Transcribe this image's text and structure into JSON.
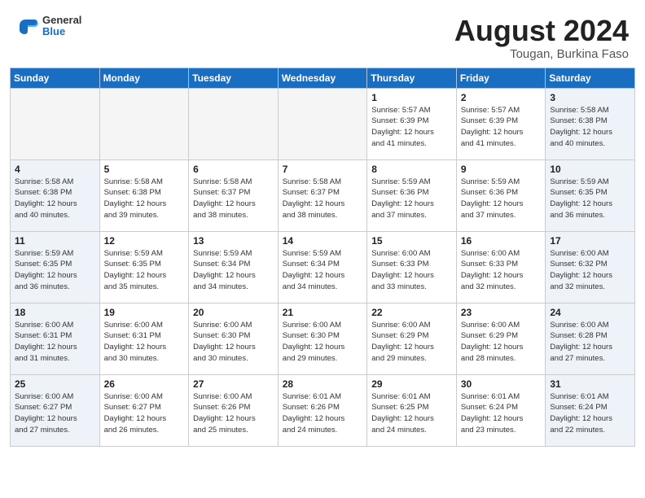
{
  "header": {
    "logo_general": "General",
    "logo_blue": "Blue",
    "title": "August 2024",
    "location": "Tougan, Burkina Faso"
  },
  "calendar": {
    "weekdays": [
      "Sunday",
      "Monday",
      "Tuesday",
      "Wednesday",
      "Thursday",
      "Friday",
      "Saturday"
    ],
    "weeks": [
      [
        {
          "day": "",
          "info": "",
          "type": "empty"
        },
        {
          "day": "",
          "info": "",
          "type": "empty"
        },
        {
          "day": "",
          "info": "",
          "type": "empty"
        },
        {
          "day": "",
          "info": "",
          "type": "empty"
        },
        {
          "day": "1",
          "info": "Sunrise: 5:57 AM\nSunset: 6:39 PM\nDaylight: 12 hours\nand 41 minutes.",
          "type": "weekday"
        },
        {
          "day": "2",
          "info": "Sunrise: 5:57 AM\nSunset: 6:39 PM\nDaylight: 12 hours\nand 41 minutes.",
          "type": "weekday"
        },
        {
          "day": "3",
          "info": "Sunrise: 5:58 AM\nSunset: 6:38 PM\nDaylight: 12 hours\nand 40 minutes.",
          "type": "weekend"
        }
      ],
      [
        {
          "day": "4",
          "info": "Sunrise: 5:58 AM\nSunset: 6:38 PM\nDaylight: 12 hours\nand 40 minutes.",
          "type": "weekend"
        },
        {
          "day": "5",
          "info": "Sunrise: 5:58 AM\nSunset: 6:38 PM\nDaylight: 12 hours\nand 39 minutes.",
          "type": "weekday"
        },
        {
          "day": "6",
          "info": "Sunrise: 5:58 AM\nSunset: 6:37 PM\nDaylight: 12 hours\nand 38 minutes.",
          "type": "weekday"
        },
        {
          "day": "7",
          "info": "Sunrise: 5:58 AM\nSunset: 6:37 PM\nDaylight: 12 hours\nand 38 minutes.",
          "type": "weekday"
        },
        {
          "day": "8",
          "info": "Sunrise: 5:59 AM\nSunset: 6:36 PM\nDaylight: 12 hours\nand 37 minutes.",
          "type": "weekday"
        },
        {
          "day": "9",
          "info": "Sunrise: 5:59 AM\nSunset: 6:36 PM\nDaylight: 12 hours\nand 37 minutes.",
          "type": "weekday"
        },
        {
          "day": "10",
          "info": "Sunrise: 5:59 AM\nSunset: 6:35 PM\nDaylight: 12 hours\nand 36 minutes.",
          "type": "weekend"
        }
      ],
      [
        {
          "day": "11",
          "info": "Sunrise: 5:59 AM\nSunset: 6:35 PM\nDaylight: 12 hours\nand 36 minutes.",
          "type": "weekend"
        },
        {
          "day": "12",
          "info": "Sunrise: 5:59 AM\nSunset: 6:35 PM\nDaylight: 12 hours\nand 35 minutes.",
          "type": "weekday"
        },
        {
          "day": "13",
          "info": "Sunrise: 5:59 AM\nSunset: 6:34 PM\nDaylight: 12 hours\nand 34 minutes.",
          "type": "weekday"
        },
        {
          "day": "14",
          "info": "Sunrise: 5:59 AM\nSunset: 6:34 PM\nDaylight: 12 hours\nand 34 minutes.",
          "type": "weekday"
        },
        {
          "day": "15",
          "info": "Sunrise: 6:00 AM\nSunset: 6:33 PM\nDaylight: 12 hours\nand 33 minutes.",
          "type": "weekday"
        },
        {
          "day": "16",
          "info": "Sunrise: 6:00 AM\nSunset: 6:33 PM\nDaylight: 12 hours\nand 32 minutes.",
          "type": "weekday"
        },
        {
          "day": "17",
          "info": "Sunrise: 6:00 AM\nSunset: 6:32 PM\nDaylight: 12 hours\nand 32 minutes.",
          "type": "weekend"
        }
      ],
      [
        {
          "day": "18",
          "info": "Sunrise: 6:00 AM\nSunset: 6:31 PM\nDaylight: 12 hours\nand 31 minutes.",
          "type": "weekend"
        },
        {
          "day": "19",
          "info": "Sunrise: 6:00 AM\nSunset: 6:31 PM\nDaylight: 12 hours\nand 30 minutes.",
          "type": "weekday"
        },
        {
          "day": "20",
          "info": "Sunrise: 6:00 AM\nSunset: 6:30 PM\nDaylight: 12 hours\nand 30 minutes.",
          "type": "weekday"
        },
        {
          "day": "21",
          "info": "Sunrise: 6:00 AM\nSunset: 6:30 PM\nDaylight: 12 hours\nand 29 minutes.",
          "type": "weekday"
        },
        {
          "day": "22",
          "info": "Sunrise: 6:00 AM\nSunset: 6:29 PM\nDaylight: 12 hours\nand 29 minutes.",
          "type": "weekday"
        },
        {
          "day": "23",
          "info": "Sunrise: 6:00 AM\nSunset: 6:29 PM\nDaylight: 12 hours\nand 28 minutes.",
          "type": "weekday"
        },
        {
          "day": "24",
          "info": "Sunrise: 6:00 AM\nSunset: 6:28 PM\nDaylight: 12 hours\nand 27 minutes.",
          "type": "weekend"
        }
      ],
      [
        {
          "day": "25",
          "info": "Sunrise: 6:00 AM\nSunset: 6:27 PM\nDaylight: 12 hours\nand 27 minutes.",
          "type": "weekend"
        },
        {
          "day": "26",
          "info": "Sunrise: 6:00 AM\nSunset: 6:27 PM\nDaylight: 12 hours\nand 26 minutes.",
          "type": "weekday"
        },
        {
          "day": "27",
          "info": "Sunrise: 6:00 AM\nSunset: 6:26 PM\nDaylight: 12 hours\nand 25 minutes.",
          "type": "weekday"
        },
        {
          "day": "28",
          "info": "Sunrise: 6:01 AM\nSunset: 6:26 PM\nDaylight: 12 hours\nand 24 minutes.",
          "type": "weekday"
        },
        {
          "day": "29",
          "info": "Sunrise: 6:01 AM\nSunset: 6:25 PM\nDaylight: 12 hours\nand 24 minutes.",
          "type": "weekday"
        },
        {
          "day": "30",
          "info": "Sunrise: 6:01 AM\nSunset: 6:24 PM\nDaylight: 12 hours\nand 23 minutes.",
          "type": "weekday"
        },
        {
          "day": "31",
          "info": "Sunrise: 6:01 AM\nSunset: 6:24 PM\nDaylight: 12 hours\nand 22 minutes.",
          "type": "weekend"
        }
      ]
    ]
  }
}
